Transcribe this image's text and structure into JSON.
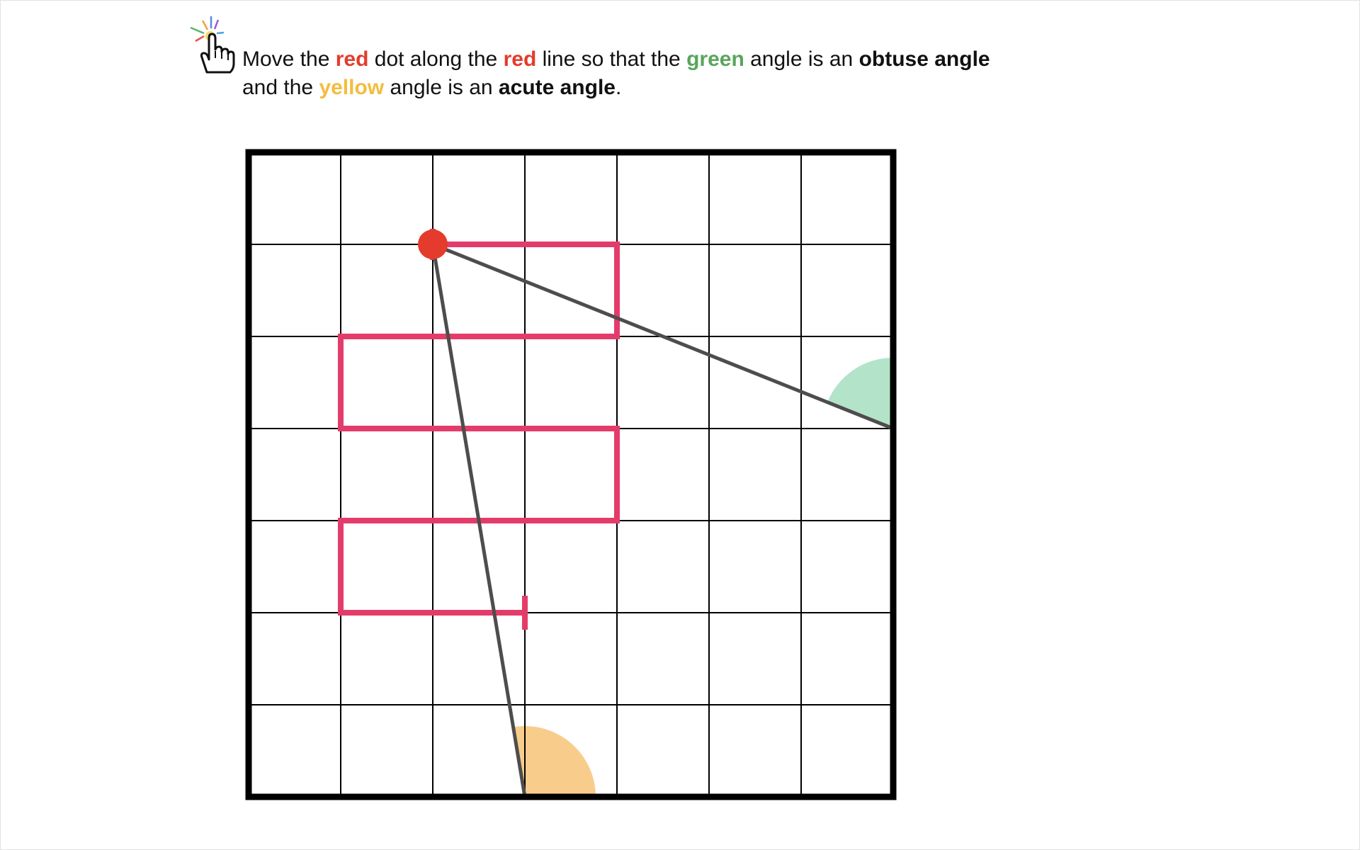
{
  "instruction": {
    "t1": "Move the ",
    "w_red1": "red",
    "t2": " dot along the ",
    "w_red2": "red",
    "t3": " line so that the ",
    "w_green": "green",
    "t4": " angle is an ",
    "w_obtuse": "obtuse angle",
    "t5": "and the ",
    "w_yellow": "yellow",
    "t6": " angle is an ",
    "w_acute": "acute angle",
    "t7": "."
  },
  "icons": {
    "hint": "hand-pointer-sparkle-icon"
  },
  "colors": {
    "red": "#e53b2c",
    "path": "#e43c6a",
    "green_angle": "#b3e3c8",
    "yellow_angle": "#f8cd8c",
    "ray": "#4d4d4d",
    "grid": "#000000",
    "green_text": "#58a65c",
    "yellow_text": "#f3bd3d"
  },
  "grid": {
    "columns": 7,
    "rows": 7
  },
  "puzzle": {
    "dot": [
      2,
      1
    ],
    "green_vertex": [
      7,
      3
    ],
    "yellow_vertex": [
      3,
      7
    ],
    "path": [
      [
        2,
        1
      ],
      [
        4,
        1
      ],
      [
        4,
        2
      ],
      [
        1,
        2
      ],
      [
        1,
        3
      ],
      [
        4,
        3
      ],
      [
        4,
        4
      ],
      [
        1,
        4
      ],
      [
        1,
        5
      ],
      [
        3,
        5
      ]
    ],
    "path_start": [
      2,
      1
    ],
    "path_end": [
      3,
      5
    ]
  }
}
